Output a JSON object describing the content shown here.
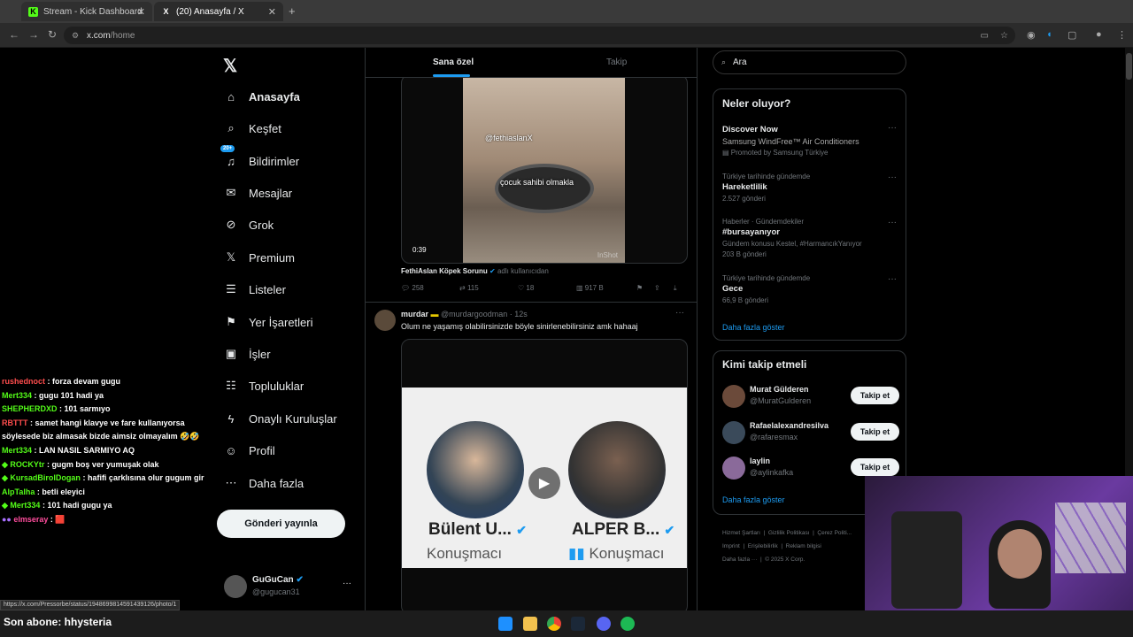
{
  "browser": {
    "tabs": [
      {
        "label": "Stream - Kick Dashboard",
        "fav": "K",
        "fav_color": "#53fc18"
      },
      {
        "label": "(20) Anasayfa / X",
        "fav": "X",
        "fav_color": "#ffffff"
      }
    ],
    "url_domain": "x.com",
    "url_path": "/home",
    "status_url": "https://x.com/Pressorbe/status/1948699814591439126/photo/1"
  },
  "chat": [
    {
      "user": "rushednoct",
      "color": "#ff4d4d",
      "msg": "forza devam gugu"
    },
    {
      "user": "Mert334",
      "color": "#53fc18",
      "msg": "gugu 101 hadi ya"
    },
    {
      "user": "SHEPHERDXD",
      "color": "#53fc18",
      "msg": "101 sarmıyo"
    },
    {
      "user": "RBTTT",
      "color": "#ff4d4d",
      "msg": "samet hangi klavye ve fare kullanıyorsa söylesede biz almasak bizde aimsiz olmayalım 🤣🤣"
    },
    {
      "user": "Mert334",
      "color": "#53fc18",
      "msg": "LAN NASIL SARMIYO AQ"
    },
    {
      "user": "ROCKYtr",
      "color": "#53fc18",
      "msg": "gugm boş ver yumuşak olak"
    },
    {
      "user": "KursadBirolDogan",
      "color": "#53fc18",
      "msg": "hafifi çarklısına olur gugum gir"
    },
    {
      "user": "AlpTalha",
      "color": "#53fc18",
      "msg": "betli eleyici"
    },
    {
      "user": "Mert334",
      "color": "#53fc18",
      "msg": "101 hadi gugu ya"
    },
    {
      "user": "elmseray",
      "color": "#ff4d9d",
      "msg": "🟥"
    }
  ],
  "nav": {
    "items": [
      {
        "label": "Anasayfa",
        "icon": "home-icon",
        "glyph": "⌂"
      },
      {
        "label": "Keşfet",
        "icon": "search-icon",
        "glyph": "⌕"
      },
      {
        "label": "Bildirimler",
        "icon": "bell-icon",
        "glyph": "🔔"
      },
      {
        "label": "Mesajlar",
        "icon": "mail-icon",
        "glyph": "✉"
      },
      {
        "label": "Grok",
        "icon": "grok-icon",
        "glyph": "⊘"
      },
      {
        "label": "Premium",
        "icon": "x-logo-icon",
        "glyph": "𝕏"
      },
      {
        "label": "Listeler",
        "icon": "list-icon",
        "glyph": "☰"
      },
      {
        "label": "Yer İşaretleri",
        "icon": "bookmark-icon",
        "glyph": "⚑"
      },
      {
        "label": "İşler",
        "icon": "briefcase-icon",
        "glyph": "▣"
      },
      {
        "label": "Topluluklar",
        "icon": "communities-icon",
        "glyph": "☷"
      },
      {
        "label": "Onaylı Kuruluşlar",
        "icon": "lightning-icon",
        "glyph": "ϟ"
      },
      {
        "label": "Profil",
        "icon": "person-icon",
        "glyph": "☺"
      },
      {
        "label": "Daha fazla",
        "icon": "more-circle-icon",
        "glyph": "⋯"
      }
    ],
    "notif_badge": "20+",
    "post_button": "Gönderi yayınla",
    "profile_name": "GuGuCan",
    "profile_handle": "@gugucan31"
  },
  "timeline": {
    "tab_foryou": "Sana özel",
    "tab_following": "Takip",
    "tweet1": {
      "video_overlay_handle": "@fethiaslanX",
      "video_caption": "çocuk sahibi olmakla",
      "duration": "0:39",
      "watermark": "InShot",
      "source_name": "FethiAslan Köpek Sorunu",
      "source_suffix": "adlı kullanıcıdan",
      "replies": "258",
      "retweets": "115",
      "likes": "18",
      "views": "917 B"
    },
    "tweet2": {
      "name": "murdar",
      "handle": "@murdargoodman",
      "time": "12s",
      "text": "Olum ne yaşamış olabilirsinizde böyle sinirlenebilirsiniz amk hahaaj",
      "left_name": "Bülent U...",
      "left_role": "Konuşmacı",
      "right_name": "ALPER B...",
      "right_role": "Konuşmacı"
    }
  },
  "sidebar": {
    "search_placeholder": "Ara",
    "trends_title": "Neler oluyor?",
    "trends": [
      {
        "meta": "Discover Now",
        "title": "Samsung WindFree™ Air Conditioners",
        "sub": "Promoted by Samsung Türkiye"
      },
      {
        "meta": "Türkiye tarihinde gündemde",
        "title": "Hareketlilik",
        "sub": "2.527 gönderi"
      },
      {
        "meta": "Haberler · Gündemdekiler",
        "title": "#bursayanıyor",
        "sub": "Gündem konusu Kestel, #HarmancıkYanıyor",
        "sub2": "203 B gönderi"
      },
      {
        "meta": "Türkiye tarihinde gündemde",
        "title": "Gece",
        "sub": "66,9 B gönderi"
      }
    ],
    "show_more": "Daha fazla göster",
    "follow_title": "Kimi takip etmeli",
    "follow": [
      {
        "name": "Murat Gülderen",
        "handle": "@MuratGulderen"
      },
      {
        "name": "Rafaelalexandresilva",
        "handle": "@rafaresmax"
      },
      {
        "name": "laylin",
        "handle": "@aylinkafka"
      }
    ],
    "follow_btn": "Takip et",
    "follow_more": "Daha fazla göster",
    "footer": [
      "Hizmet Şartları",
      "Gizlilik Politikası",
      "Çerez Politi...",
      "Imprint",
      "Erişilebilirlik",
      "Reklam bilgisi",
      "Daha fazla ···",
      "© 2025 X Corp."
    ]
  },
  "overlay": {
    "sub_label": "Son abone: hhysteria"
  },
  "colors": {
    "accent": "#1d9bf0",
    "kick": "#53fc18"
  }
}
